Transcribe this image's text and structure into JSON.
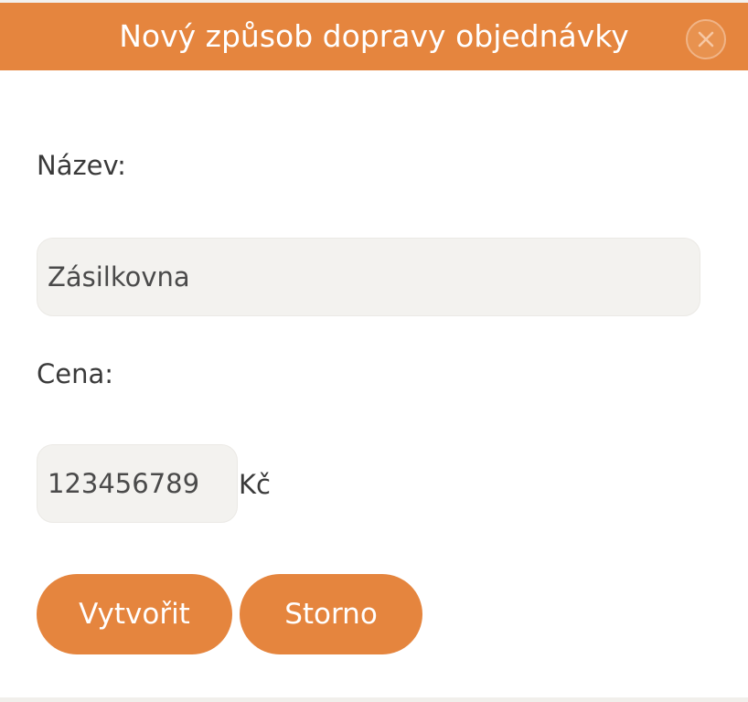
{
  "dialog": {
    "title": "Nový způsob dopravy objednávky",
    "close_icon": "close-icon"
  },
  "form": {
    "name_label": "Název:",
    "name_value": "Zásilkovna",
    "price_label": "Cena:",
    "price_value": "123456789",
    "currency": "Kč"
  },
  "buttons": {
    "create_label": "Vytvořit",
    "cancel_label": "Storno"
  },
  "colors": {
    "accent": "#e5853e",
    "input_bg": "#f3f2ef",
    "text": "#3a3a3a"
  }
}
